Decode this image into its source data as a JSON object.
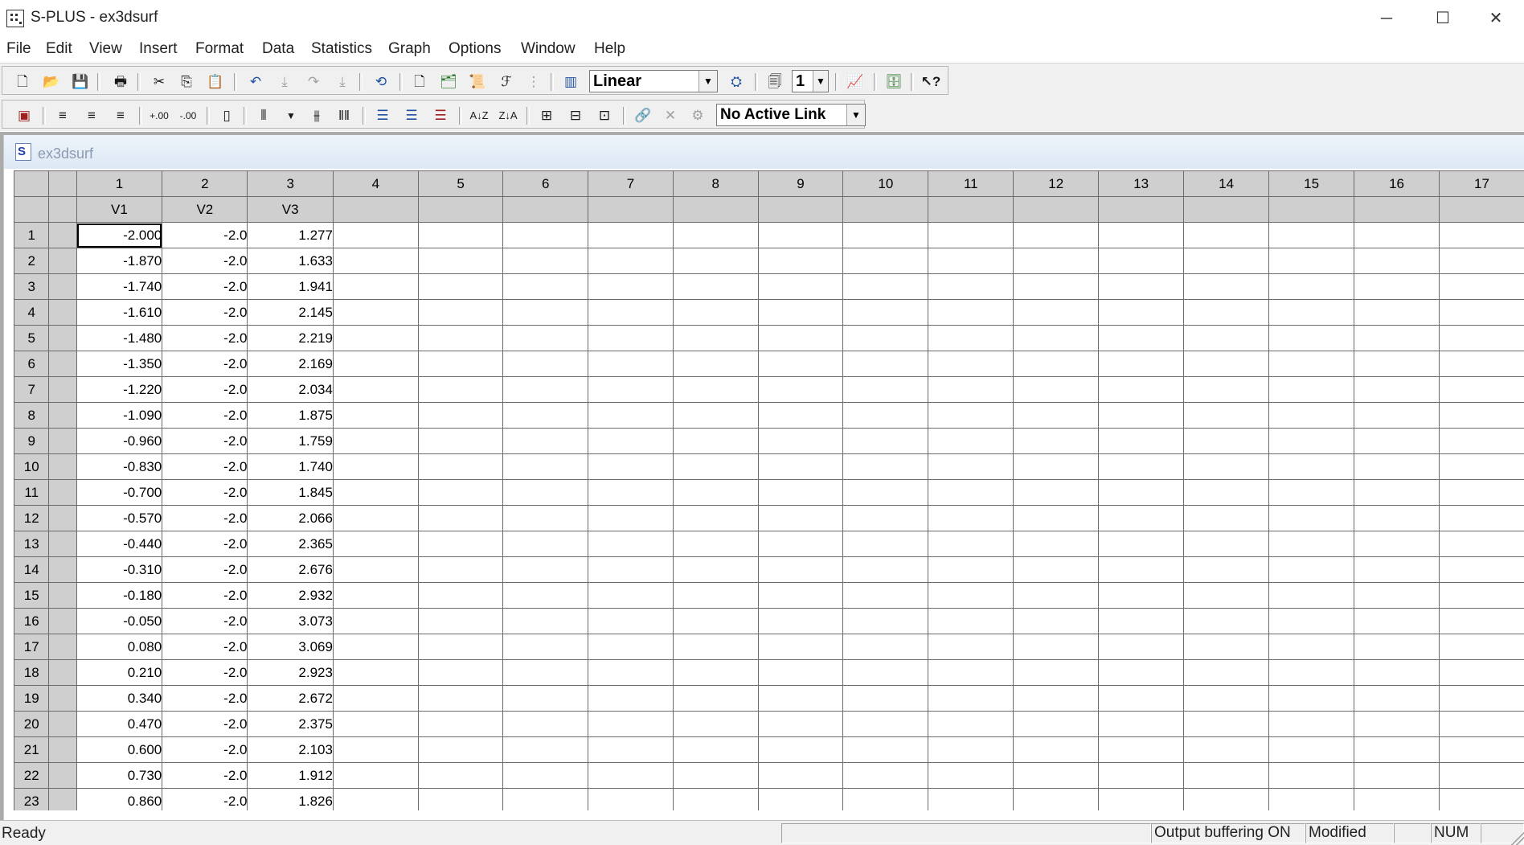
{
  "window": {
    "title": "S-PLUS - ex3dsurf",
    "minimize_glyph": "─",
    "maximize_glyph": "☐",
    "close_glyph": "✕"
  },
  "menu": [
    "File",
    "Edit",
    "View",
    "Insert",
    "Format",
    "Data",
    "Statistics",
    "Graph",
    "Options",
    "Window",
    "Help"
  ],
  "toolbar1": {
    "scale_combo": "Linear",
    "page_combo": "1"
  },
  "toolbar2": {
    "link_combo": "No Active Link"
  },
  "document": {
    "name": "ex3dsurf",
    "icon_letter": "S"
  },
  "grid": {
    "column_numbers": [
      "1",
      "2",
      "3",
      "4",
      "5",
      "6",
      "7",
      "8",
      "9",
      "10",
      "11",
      "12",
      "13",
      "14",
      "15",
      "16",
      "17"
    ],
    "column_names": [
      "V1",
      "V2",
      "V3",
      "",
      "",
      "",
      "",
      "",
      "",
      "",
      "",
      "",
      "",
      "",
      "",
      "",
      ""
    ],
    "rows": [
      {
        "n": "1",
        "v1": "-2.000",
        "v2": "-2.0",
        "v3": "1.277"
      },
      {
        "n": "2",
        "v1": "-1.870",
        "v2": "-2.0",
        "v3": "1.633"
      },
      {
        "n": "3",
        "v1": "-1.740",
        "v2": "-2.0",
        "v3": "1.941"
      },
      {
        "n": "4",
        "v1": "-1.610",
        "v2": "-2.0",
        "v3": "2.145"
      },
      {
        "n": "5",
        "v1": "-1.480",
        "v2": "-2.0",
        "v3": "2.219"
      },
      {
        "n": "6",
        "v1": "-1.350",
        "v2": "-2.0",
        "v3": "2.169"
      },
      {
        "n": "7",
        "v1": "-1.220",
        "v2": "-2.0",
        "v3": "2.034"
      },
      {
        "n": "8",
        "v1": "-1.090",
        "v2": "-2.0",
        "v3": "1.875"
      },
      {
        "n": "9",
        "v1": "-0.960",
        "v2": "-2.0",
        "v3": "1.759"
      },
      {
        "n": "10",
        "v1": "-0.830",
        "v2": "-2.0",
        "v3": "1.740"
      },
      {
        "n": "11",
        "v1": "-0.700",
        "v2": "-2.0",
        "v3": "1.845"
      },
      {
        "n": "12",
        "v1": "-0.570",
        "v2": "-2.0",
        "v3": "2.066"
      },
      {
        "n": "13",
        "v1": "-0.440",
        "v2": "-2.0",
        "v3": "2.365"
      },
      {
        "n": "14",
        "v1": "-0.310",
        "v2": "-2.0",
        "v3": "2.676"
      },
      {
        "n": "15",
        "v1": "-0.180",
        "v2": "-2.0",
        "v3": "2.932"
      },
      {
        "n": "16",
        "v1": "-0.050",
        "v2": "-2.0",
        "v3": "3.073"
      },
      {
        "n": "17",
        "v1": "0.080",
        "v2": "-2.0",
        "v3": "3.069"
      },
      {
        "n": "18",
        "v1": "0.210",
        "v2": "-2.0",
        "v3": "2.923"
      },
      {
        "n": "19",
        "v1": "0.340",
        "v2": "-2.0",
        "v3": "2.672"
      },
      {
        "n": "20",
        "v1": "0.470",
        "v2": "-2.0",
        "v3": "2.375"
      },
      {
        "n": "21",
        "v1": "0.600",
        "v2": "-2.0",
        "v3": "2.103"
      },
      {
        "n": "22",
        "v1": "0.730",
        "v2": "-2.0",
        "v3": "1.912"
      },
      {
        "n": "23",
        "v1": "0.860",
        "v2": "-2.0",
        "v3": "1.826"
      }
    ]
  },
  "status": {
    "ready": "Ready",
    "buffering": "Output buffering ON",
    "modified": "Modified",
    "num": "NUM"
  }
}
